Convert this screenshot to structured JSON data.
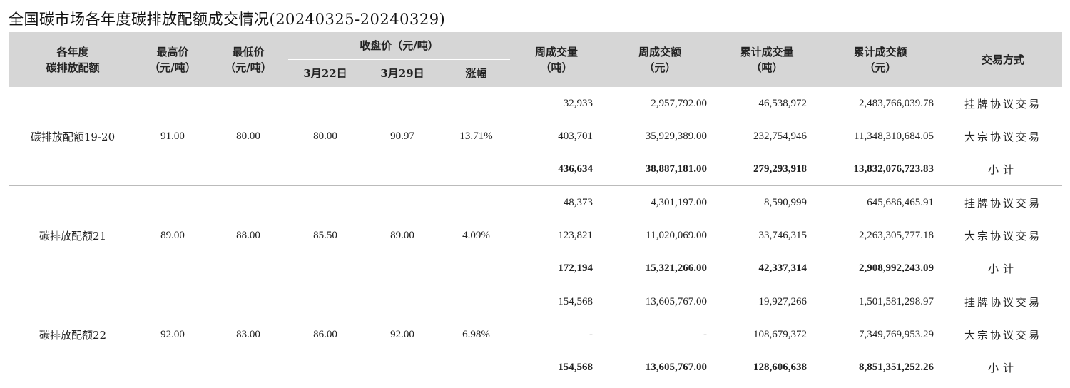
{
  "title": "全国碳市场各年度碳排放配额成交情况(20240325-20240329)",
  "headers": {
    "allowance": [
      "各年度",
      "碳排放配额"
    ],
    "high": [
      "最高价",
      "（元/吨）"
    ],
    "low": [
      "最低价",
      "（元/吨）"
    ],
    "close_group": "收盘价（元/吨）",
    "close_prev": "3月22日",
    "close_curr": "3月29日",
    "change": "涨幅",
    "week_vol": [
      "周成交量",
      "（吨）"
    ],
    "week_amt": [
      "周成交额",
      "（元）"
    ],
    "cum_vol": [
      "累计成交量",
      "（吨）"
    ],
    "cum_amt": [
      "累计成交额",
      "（元）"
    ],
    "method": "交易方式"
  },
  "groups": [
    {
      "name": "碳排放配额19-20",
      "high": "91.00",
      "low": "80.00",
      "close_prev": "80.00",
      "close_curr": "90.97",
      "change": "13.71%",
      "rows": [
        {
          "week_vol": "32,933",
          "week_amt": "2,957,792.00",
          "cum_vol": "46,538,972",
          "cum_amt": "2,483,766,039.78",
          "method": "挂牌协议交易"
        },
        {
          "week_vol": "403,701",
          "week_amt": "35,929,389.00",
          "cum_vol": "232,754,946",
          "cum_amt": "11,348,310,684.05",
          "method": "大宗协议交易"
        },
        {
          "week_vol": "436,634",
          "week_amt": "38,887,181.00",
          "cum_vol": "279,293,918",
          "cum_amt": "13,832,076,723.83",
          "method": "小计"
        }
      ]
    },
    {
      "name": "碳排放配额21",
      "high": "89.00",
      "low": "88.00",
      "close_prev": "85.50",
      "close_curr": "89.00",
      "change": "4.09%",
      "rows": [
        {
          "week_vol": "48,373",
          "week_amt": "4,301,197.00",
          "cum_vol": "8,590,999",
          "cum_amt": "645,686,465.91",
          "method": "挂牌协议交易"
        },
        {
          "week_vol": "123,821",
          "week_amt": "11,020,069.00",
          "cum_vol": "33,746,315",
          "cum_amt": "2,263,305,777.18",
          "method": "大宗协议交易"
        },
        {
          "week_vol": "172,194",
          "week_amt": "15,321,266.00",
          "cum_vol": "42,337,314",
          "cum_amt": "2,908,992,243.09",
          "method": "小计"
        }
      ]
    },
    {
      "name": "碳排放配额22",
      "high": "92.00",
      "low": "83.00",
      "close_prev": "86.00",
      "close_curr": "92.00",
      "change": "6.98%",
      "rows": [
        {
          "week_vol": "154,568",
          "week_amt": "13,605,767.00",
          "cum_vol": "19,927,266",
          "cum_amt": "1,501,581,298.97",
          "method": "挂牌协议交易"
        },
        {
          "week_vol": "-",
          "week_amt": "-",
          "cum_vol": "108,679,372",
          "cum_amt": "7,349,769,953.29",
          "method": "大宗协议交易"
        },
        {
          "week_vol": "154,568",
          "week_amt": "13,605,767.00",
          "cum_vol": "128,606,638",
          "cum_amt": "8,851,351,252.26",
          "method": "小计"
        }
      ]
    }
  ]
}
